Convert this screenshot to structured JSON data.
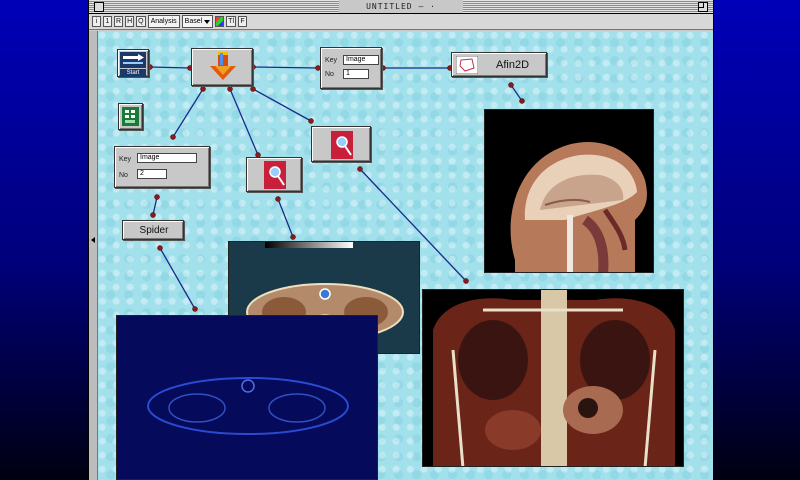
{
  "window": {
    "title": "UNTITLED",
    "title_suffix": "— ·"
  },
  "toolbar": {
    "buttons": [
      {
        "label": "i"
      },
      {
        "label": "1"
      },
      {
        "label": "R"
      },
      {
        "label": "H"
      },
      {
        "label": "Q"
      }
    ],
    "select1_label": "Analysis",
    "select2_label": "Basel",
    "btn_t": "Tl",
    "btn_f": "F"
  },
  "nodes": {
    "start_label": "Start",
    "key_node_1": {
      "key_label": "Key",
      "key_value": "Image",
      "no_label": "No",
      "no_value": "1"
    },
    "key_node_2": {
      "key_label": "Key",
      "key_value": "Image",
      "no_label": "No",
      "no_value": "2"
    },
    "afin2d_label": "Afin2D",
    "spider_label": "Spider"
  },
  "colors": {
    "canvas": "#a2e0ec",
    "desktop": "#0000b8",
    "wire": "#1a2a8a"
  },
  "icons": [
    "start-icon",
    "download-arrow-icon",
    "spreadsheet-icon",
    "magnifier-icon",
    "magnifier-icon",
    "polygon-icon"
  ]
}
